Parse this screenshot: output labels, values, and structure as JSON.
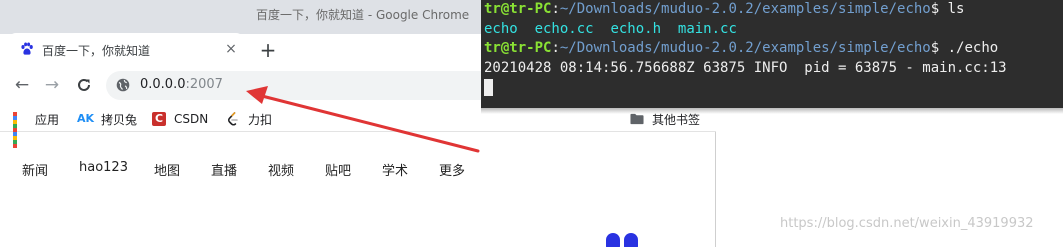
{
  "window": {
    "title": "百度一下，你就知道 - Google Chrome"
  },
  "tab": {
    "title": "百度一下，你就知道",
    "close_icon": "×",
    "new_tab_icon": "+"
  },
  "toolbar": {
    "back_icon": "←",
    "forward_icon": "→",
    "reload_icon": "C",
    "url_host": "0.0.0.0",
    "url_port": ":2007"
  },
  "bookmarks": {
    "apps": "应用",
    "akb_icon": "AK",
    "akb": "拷贝兔",
    "csdn_icon": "C",
    "csdn": "CSDN",
    "leetcode": "力扣",
    "other": "其他书签"
  },
  "baidu_nav": {
    "items": [
      "新闻",
      "hao123",
      "地图",
      "直播",
      "视频",
      "贴吧",
      "学术",
      "更多"
    ]
  },
  "terminal": {
    "user": "tr@tr-PC",
    "sep": ":",
    "path": "~/Downloads/muduo-2.0.2/examples/simple/echo",
    "cmd1": "$ ls",
    "files": [
      "echo",
      "echo.cc",
      "echo.h",
      "main.cc"
    ],
    "cmd2": "$ ./echo",
    "log_line": "20210428 08:14:56.756688Z 63875 INFO  pid = 63875 - main.cc:13"
  },
  "watermark": "https://blog.csdn.net/weixin_43919932",
  "colors": {
    "annotation_arrow": "#e03535",
    "terminal_bg": "#2d2d2d",
    "prompt_user": "#8ae234",
    "prompt_path": "#729fcf",
    "file_listing": "#34e2e2",
    "baidu_blue": "#2932e1"
  }
}
